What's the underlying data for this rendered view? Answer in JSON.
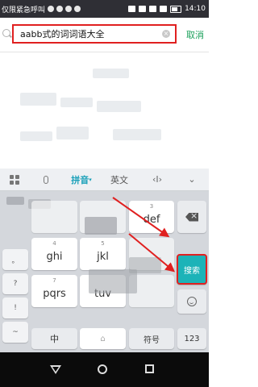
{
  "status_bar": {
    "carrier": "仅限紧急呼叫",
    "time": "14:10"
  },
  "search": {
    "query": "aabb式的词词语大全",
    "cancel_label": "取消"
  },
  "keyboard": {
    "toolbar": {
      "pinyin_label": "拼音",
      "english_label": "英文"
    },
    "left_column": [
      "。",
      "?",
      "!",
      "~"
    ],
    "keys": {
      "r2c3_label": "def",
      "r2c3_num": "3",
      "r3c1_num": "4",
      "r3c1_label": "ghi",
      "r3c2_num": "5",
      "r3c2_label": "jkl",
      "r4c1_num": "7",
      "r4c1_label": "pqrs",
      "r4c2_label": "tuv",
      "bottom_zh": "中",
      "bottom_symbol": "符号",
      "bottom_123": "123",
      "search_key": "搜索"
    }
  },
  "colors": {
    "accent_green": "#1aa05a",
    "highlight_red": "#e02020",
    "search_key_teal": "#1cb3b8"
  }
}
